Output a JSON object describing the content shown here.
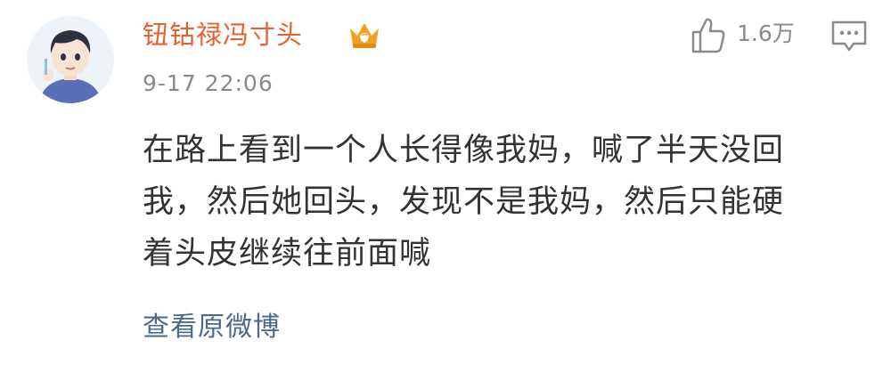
{
  "comment": {
    "author": {
      "name": "钮钴禄冯寸头",
      "avatar_icon": "cartoon-boy-avatar",
      "badge_icon": "crown-badge-icon"
    },
    "timestamp": "9-17 22:06",
    "likes": "1.6万",
    "content_lines": [
      "在路上看到一个人长得像我妈，喊了半天没回",
      "我，然后她回头，发现不是我妈，然后只能硬",
      "着头皮继续往前面喊"
    ],
    "view_original_label": "查看原微博"
  },
  "colors": {
    "username": "#e8612d",
    "badge": "#f0a21c",
    "meta": "#8a8a8a",
    "body_text": "#333333",
    "link": "#4a6a8c"
  }
}
